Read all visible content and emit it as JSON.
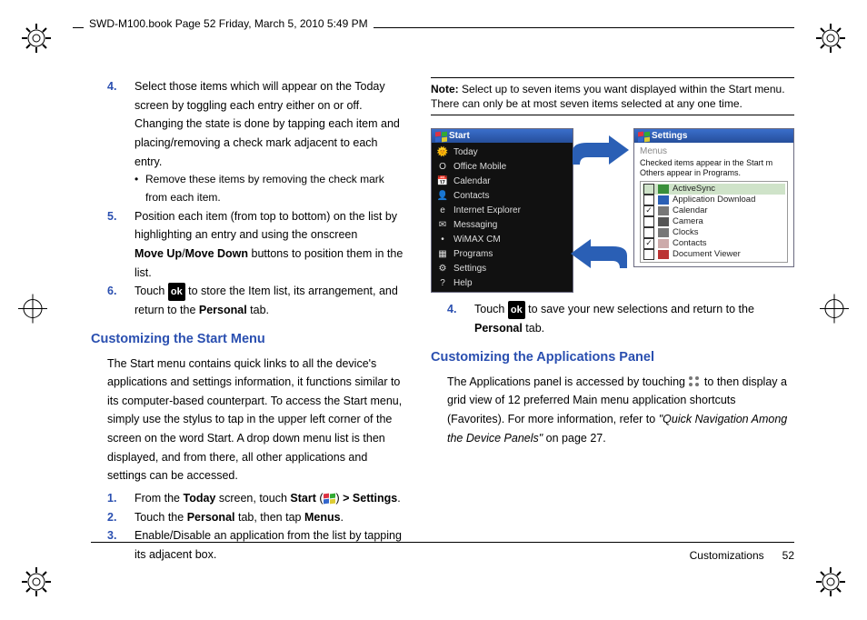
{
  "header": {
    "crop_text": "SWD-M100.book  Page 52  Friday, March 5, 2010  5:49 PM"
  },
  "left": {
    "steps": {
      "s4": {
        "num": "4.",
        "text": "Select those items which will appear on the Today screen by toggling each entry either on or off. Changing the state is done by tapping each item and placing/removing a check mark adjacent to each entry."
      },
      "s4_bullet": "Remove these items by removing the check mark from each item.",
      "s5": {
        "num": "5.",
        "text_a": "Position each item (from top to bottom) on the list by highlighting an entry and using the onscreen ",
        "bold1": "Move Up",
        "slash": "/",
        "bold2": "Move Down",
        "text_b": " buttons to position them in the list."
      },
      "s6": {
        "num": "6.",
        "text_a": "Touch ",
        "ok": "ok",
        "text_b": " to store the Item list, its arrangement, and return to the ",
        "bold": "Personal",
        "text_c": " tab."
      }
    },
    "heading1": "Customizing the Start Menu",
    "para1": "The Start menu contains quick links to all the device's applications and settings information, it functions similar to its computer-based counterpart. To access the Start menu, simply use the stylus to tap in the upper left corner of the screen on the word Start. A drop down menu list is then displayed, and from there, all other applications and settings can be accessed.",
    "list2": {
      "s1": {
        "num": "1.",
        "a": "From the ",
        "b1": "Today",
        "b": " screen, touch ",
        "b2": "Start",
        "c": " (",
        "d": ") ",
        "b3": "> Settings",
        "e": "."
      },
      "s2": {
        "num": "2.",
        "a": "Touch the ",
        "b1": "Personal",
        "b": " tab, then tap ",
        "b2": "Menus",
        "c": "."
      },
      "s3": {
        "num": "3.",
        "a": "Enable/Disable an application from the list by tapping its adjacent box."
      }
    }
  },
  "right": {
    "note_label": "Note:",
    "note_text": "Select up to seven items you want displayed within the Start menu. There can only be at most seven items selected at any one time.",
    "start_menu": {
      "title": "Start",
      "items": [
        {
          "icon": "🌞",
          "label": "Today"
        },
        {
          "icon": "O",
          "label": "Office Mobile"
        },
        {
          "icon": "📅",
          "label": "Calendar"
        },
        {
          "icon": "👤",
          "label": "Contacts"
        },
        {
          "icon": "e",
          "label": "Internet Explorer"
        },
        {
          "icon": "✉",
          "label": "Messaging"
        },
        {
          "icon": "•",
          "label": "WiMAX CM"
        },
        {
          "icon": "▦",
          "label": "Programs"
        },
        {
          "icon": "⚙",
          "label": "Settings"
        },
        {
          "icon": "?",
          "label": "Help"
        }
      ]
    },
    "settings": {
      "title": "Settings",
      "subtitle": "Menus",
      "hint": "Checked items appear in the Start m\nOthers appear in Programs.",
      "rows": [
        {
          "checked": false,
          "color": "#3a8f3a",
          "label": "ActiveSync",
          "selected": true
        },
        {
          "checked": false,
          "color": "#2a5fb5",
          "label": "Application Download"
        },
        {
          "checked": true,
          "color": "#777",
          "label": "Calendar"
        },
        {
          "checked": false,
          "color": "#555",
          "label": "Camera"
        },
        {
          "checked": false,
          "color": "#777",
          "label": "Clocks"
        },
        {
          "checked": true,
          "color": "#caa",
          "label": "Contacts"
        },
        {
          "checked": false,
          "color": "#b33",
          "label": "Document Viewer"
        }
      ]
    },
    "step4": {
      "num": "4.",
      "a": "Touch ",
      "ok": "ok",
      "b": " to save your new selections and return to the ",
      "bold": "Personal",
      "c": " tab."
    },
    "heading2": "Customizing the Applications Panel",
    "para2_a": "The Applications panel is accessed by touching ",
    "para2_b": " to then display a grid view of 12 preferred Main menu application shortcuts (Favorites). For more information, refer to ",
    "para2_ref": "\"Quick Navigation Among the Device Panels\"",
    "para2_c": "  on page 27."
  },
  "footer": {
    "section": "Customizations",
    "page": "52"
  }
}
